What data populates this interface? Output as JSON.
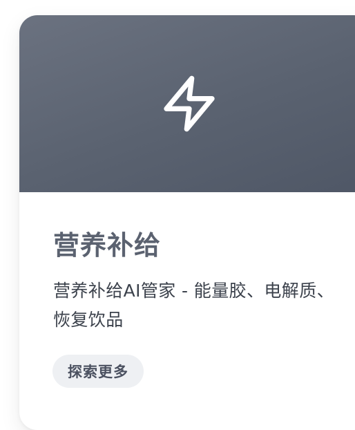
{
  "card": {
    "icon": "lightning-bolt-icon",
    "title": "营养补给",
    "description": "营养补给AI管家 - 能量胶、电解质、恢复饮品",
    "button_label": "探索更多",
    "colors": {
      "hero_gradient_start": "#6b7280",
      "hero_gradient_end": "#4f5766",
      "title": "#5b6270",
      "button_bg": "#eef0f3"
    }
  }
}
